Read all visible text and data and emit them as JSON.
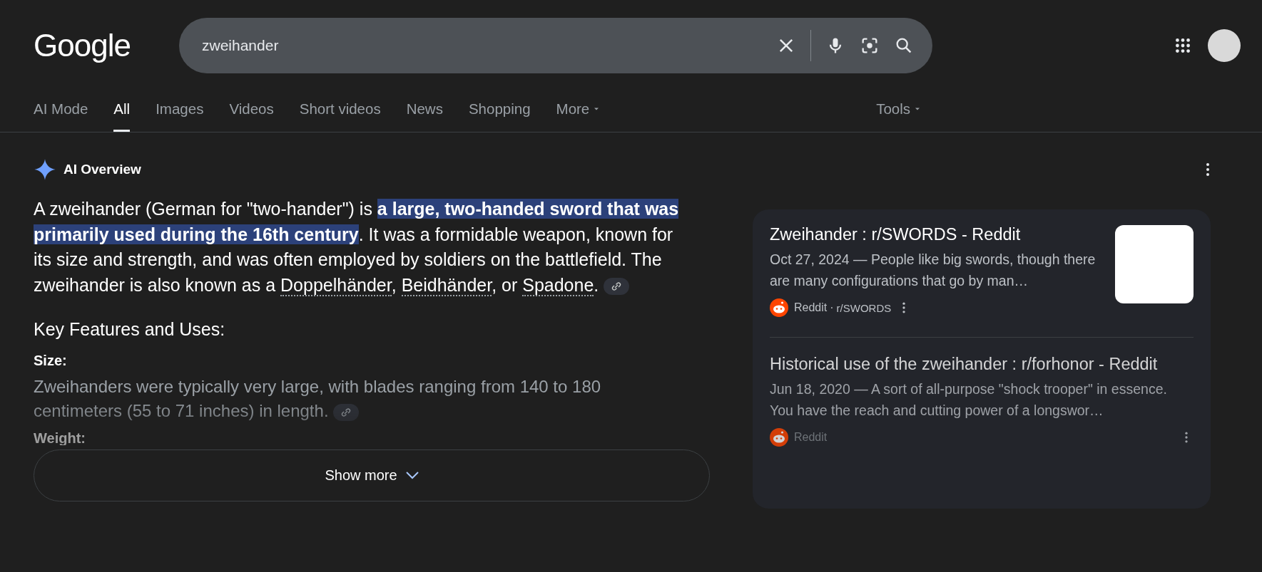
{
  "header": {
    "logo": "Google",
    "search": {
      "value": "zweihander"
    }
  },
  "tabs": [
    {
      "label": "AI Mode",
      "selected": false,
      "kind": "plain"
    },
    {
      "label": "All",
      "selected": true,
      "kind": "plain"
    },
    {
      "label": "Images",
      "selected": false,
      "kind": "plain"
    },
    {
      "label": "Videos",
      "selected": false,
      "kind": "plain"
    },
    {
      "label": "Short videos",
      "selected": false,
      "kind": "plain"
    },
    {
      "label": "News",
      "selected": false,
      "kind": "plain"
    },
    {
      "label": "Shopping",
      "selected": false,
      "kind": "plain"
    },
    {
      "label": "More",
      "selected": false,
      "kind": "menu"
    }
  ],
  "tools": {
    "label": "Tools"
  },
  "ai_overview": {
    "title": "AI Overview",
    "intro": [
      {
        "kind": "text",
        "text": "A zweihander (German for \"two-hander\") is "
      },
      {
        "kind": "highlight",
        "text": "a large, two-handed sword that was primarily used during the 16th century"
      },
      {
        "kind": "text",
        "text": ". It was a formidable weapon, known for its size and strength, and was often employed by soldiers on the battlefield. The zweihander is also known as a "
      },
      {
        "kind": "link",
        "text": "Doppelhänder"
      },
      {
        "kind": "text",
        "text": ", "
      },
      {
        "kind": "link",
        "text": "Beidhänder"
      },
      {
        "kind": "text",
        "text": ", or "
      },
      {
        "kind": "link",
        "text": "Spadone"
      },
      {
        "kind": "text",
        "text": "."
      }
    ],
    "section_heading": "Key Features and Uses:",
    "features": [
      {
        "heading": "Size:",
        "text": "Zweihanders were typically very large, with blades ranging from 140 to 180 centimeters (55 to 71 inches) in length."
      },
      {
        "heading": "Weight:"
      }
    ],
    "show_more": "Show more"
  },
  "sources": [
    {
      "title": "Zweihander : r/SWORDS - Reddit",
      "snippet": "Oct 27, 2024 — People like big swords, though there are many configurations that go by man…",
      "site": "Reddit",
      "separator": "·",
      "subreddit": "r/SWORDS",
      "thumbnail": true,
      "faded": false
    },
    {
      "title": "Historical use of the zweihander : r/forhonor - Reddit",
      "snippet": "Jun 18, 2020 — A sort of all-purpose \"shock trooper\" in essence. You have the reach and cutting power of a longswor…",
      "site": "Reddit",
      "thumbnail": false,
      "faded": true
    }
  ]
}
